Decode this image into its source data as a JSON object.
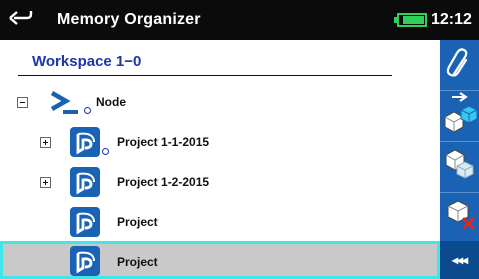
{
  "titlebar": {
    "title": "Memory Organizer",
    "time": "12:12"
  },
  "workspace": {
    "label": "Workspace 1−0"
  },
  "tree": [
    {
      "label": "Node"
    },
    {
      "label": "Project 1-1-2015"
    },
    {
      "label": "Project 1-2-2015"
    },
    {
      "label": "Project"
    },
    {
      "label": "Project"
    }
  ],
  "sidebar": {
    "more_label": "◂◂◂"
  },
  "colors": {
    "titlebar_bg": "#0b0b0b",
    "workspace_text": "#1d35a8",
    "sidebar_bg": "#1a63b4",
    "battery": "#2fd05a",
    "selection_border": "#3fe6ea",
    "selection_bg": "#c9c9c9",
    "project_icon": "#1a63b4"
  },
  "icons": {
    "back": "back-arrow-icon",
    "battery": "battery-icon",
    "paperclip": "paperclip-icon",
    "add_structure": "add-structure-icon",
    "copy_structure": "copy-structure-icon",
    "delete_structure": "delete-structure-icon",
    "node": "node-icon",
    "project": "project-icon"
  }
}
